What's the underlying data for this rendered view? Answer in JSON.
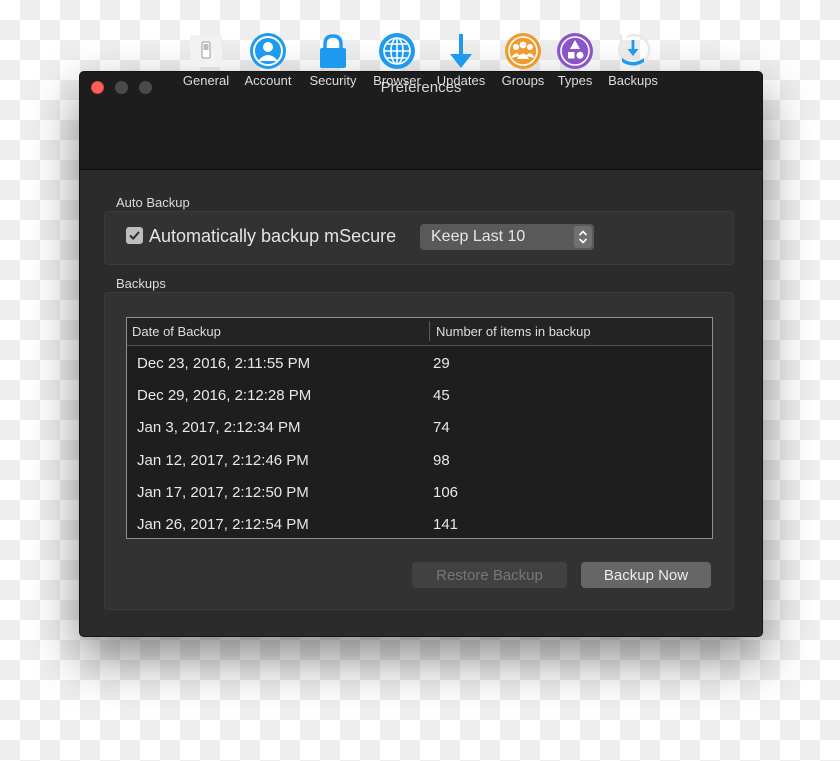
{
  "window": {
    "title": "Preferences"
  },
  "toolbar": {
    "tabs": [
      {
        "label": "General",
        "icon": "general-switch-icon"
      },
      {
        "label": "Account",
        "icon": "account-person-icon"
      },
      {
        "label": "Security",
        "icon": "lock-icon"
      },
      {
        "label": "Browser",
        "icon": "globe-icon"
      },
      {
        "label": "Updates",
        "icon": "download-arrow-icon"
      },
      {
        "label": "Groups",
        "icon": "groups-icon"
      },
      {
        "label": "Types",
        "icon": "types-shapes-icon"
      },
      {
        "label": "Backups",
        "icon": "backup-clock-icon"
      }
    ],
    "selected": "Backups"
  },
  "auto_backup": {
    "section_label": "Auto Backup",
    "checkbox_label": "Automatically backup mSecure",
    "checked": true,
    "keep_value": "Keep Last 10"
  },
  "backups": {
    "section_label": "Backups",
    "columns": [
      "Date of Backup",
      "Number of items in backup"
    ],
    "rows": [
      {
        "date": "Dec 23, 2016, 2:11:55 PM",
        "count": "29"
      },
      {
        "date": "Dec 29, 2016, 2:12:28 PM",
        "count": "45"
      },
      {
        "date": "Jan 3, 2017, 2:12:34 PM",
        "count": "74"
      },
      {
        "date": "Jan 12, 2017, 2:12:46 PM",
        "count": "98"
      },
      {
        "date": "Jan 17, 2017, 2:12:50 PM",
        "count": "106"
      },
      {
        "date": "Jan 26, 2017, 2:12:54 PM",
        "count": "141"
      }
    ],
    "restore_label": "Restore Backup",
    "backup_now_label": "Backup Now"
  },
  "colors": {
    "window_bg": "#2b2b2b",
    "titlebar_bg": "#1d1d1d",
    "close_light": "#fe5f57",
    "accent_blue": "#1e9bf0",
    "groups_orange": "#f19a2e",
    "types_purple": "#8a55c8"
  }
}
